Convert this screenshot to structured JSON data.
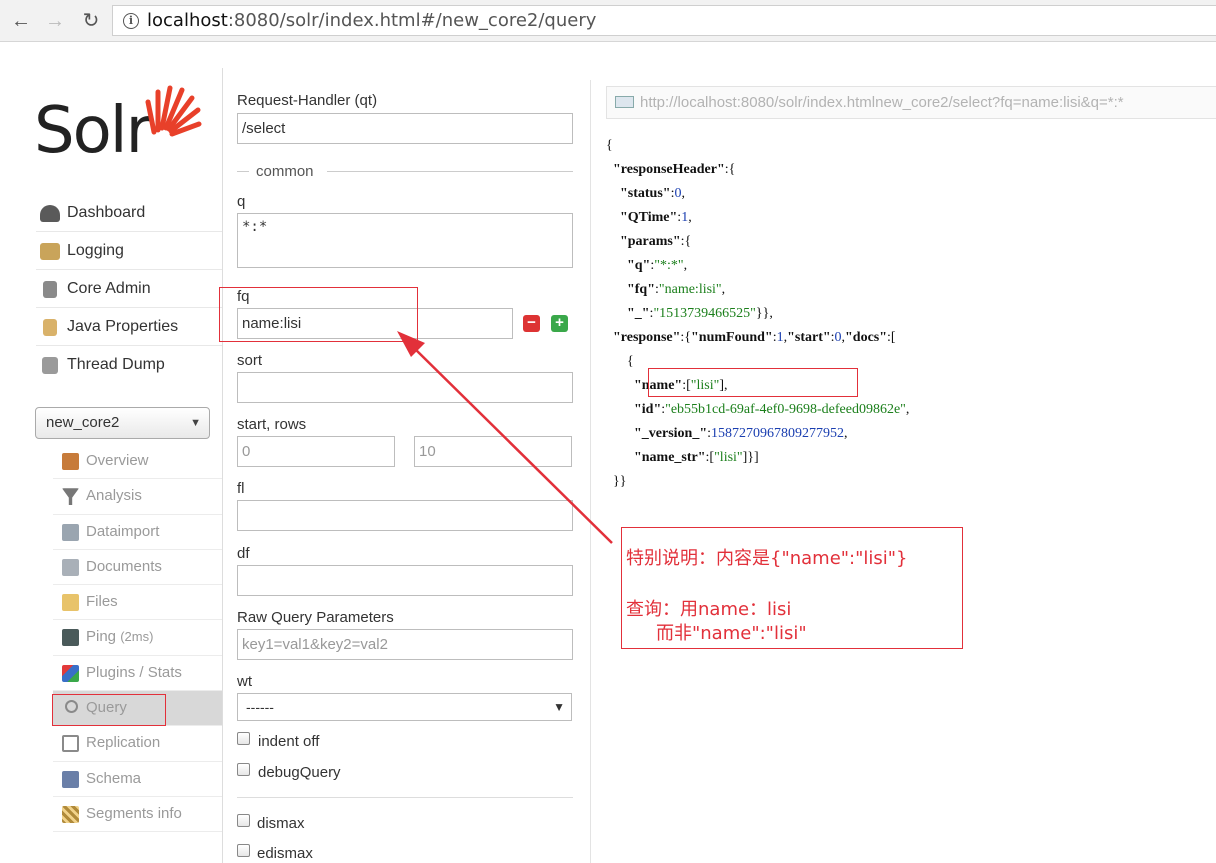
{
  "browser": {
    "back": "←",
    "forward": "→",
    "reload": "↻",
    "url_host": "localhost",
    "url_rest": ":8080/solr/index.html#/new_core2/query"
  },
  "logo": {
    "text": "Solr"
  },
  "menu": [
    {
      "label": "Dashboard",
      "icon": "dashboard-icon",
      "color": "#5a5a5a"
    },
    {
      "label": "Logging",
      "icon": "logging-icon",
      "color": "#c9a45a"
    },
    {
      "label": "Core Admin",
      "icon": "core-admin-icon",
      "color": "#8a8a8a"
    },
    {
      "label": "Java Properties",
      "icon": "java-icon",
      "color": "#d9b26a"
    },
    {
      "label": "Thread Dump",
      "icon": "thread-dump-icon",
      "color": "#9a9a9a"
    }
  ],
  "core_selector": {
    "value": "new_core2"
  },
  "submenu": [
    {
      "label": "Overview",
      "suffix": "",
      "icon": "home-icon",
      "color": "#c77b3a"
    },
    {
      "label": "Analysis",
      "suffix": "",
      "icon": "funnel-icon",
      "color": "#777777"
    },
    {
      "label": "Dataimport",
      "suffix": "",
      "icon": "dataimport-icon",
      "color": "#9aa5b0"
    },
    {
      "label": "Documents",
      "suffix": "",
      "icon": "documents-icon",
      "color": "#a9b0b8"
    },
    {
      "label": "Files",
      "suffix": "",
      "icon": "folder-icon",
      "color": "#e8c36a"
    },
    {
      "label": "Ping",
      "suffix": "(2ms)",
      "icon": "ping-icon",
      "color": "#4a5a5a"
    },
    {
      "label": "Plugins / Stats",
      "suffix": "",
      "icon": "plugins-icon",
      "color": "#3a6fc8"
    },
    {
      "label": "Query",
      "suffix": "",
      "icon": "magnifier-icon",
      "color": "#8a8a8a"
    },
    {
      "label": "Replication",
      "suffix": "",
      "icon": "replication-icon",
      "color": "#8a8a8a"
    },
    {
      "label": "Schema",
      "suffix": "",
      "icon": "schema-icon",
      "color": "#6a7fa8"
    },
    {
      "label": "Segments info",
      "suffix": "",
      "icon": "segments-icon",
      "color": "#b08a3a"
    }
  ],
  "form": {
    "request_handler_label": "Request-Handler (qt)",
    "request_handler_value": "/select",
    "common_label": "common",
    "q_label": "q",
    "q_value": "*:*",
    "fq_label": "fq",
    "fq_value": "name:lisi",
    "remove_symbol": "−",
    "add_symbol": "+",
    "sort_label": "sort",
    "start_rows_label": "start, rows",
    "start_placeholder": "0",
    "rows_placeholder": "10",
    "fl_label": "fl",
    "df_label": "df",
    "raw_label": "Raw Query Parameters",
    "raw_placeholder": "key1=val1&key2=val2",
    "wt_label": "wt",
    "wt_value": "------",
    "indent_label": "indent off",
    "debug_label": "debugQuery",
    "dismax_label": "dismax",
    "edismax_label": "edismax"
  },
  "response": {
    "request_url": "http://localhost:8080/solr/index.htmlnew_core2/select?fq=name:lisi&q=*:*",
    "json_lines": [
      [
        [
          "p",
          "{"
        ]
      ],
      [
        [
          "p",
          "  "
        ],
        [
          "k",
          "\"responseHeader\""
        ],
        [
          "p",
          ":{"
        ]
      ],
      [
        [
          "p",
          "    "
        ],
        [
          "k",
          "\"status\""
        ],
        [
          "p",
          ":"
        ],
        [
          "n",
          "0"
        ],
        [
          "p",
          ","
        ]
      ],
      [
        [
          "p",
          "    "
        ],
        [
          "k",
          "\"QTime\""
        ],
        [
          "p",
          ":"
        ],
        [
          "n",
          "1"
        ],
        [
          "p",
          ","
        ]
      ],
      [
        [
          "p",
          "    "
        ],
        [
          "k",
          "\"params\""
        ],
        [
          "p",
          ":{"
        ]
      ],
      [
        [
          "p",
          "      "
        ],
        [
          "k",
          "\"q\""
        ],
        [
          "p",
          ":"
        ],
        [
          "s",
          "\"*:*\""
        ],
        [
          "p",
          ","
        ]
      ],
      [
        [
          "p",
          "      "
        ],
        [
          "k",
          "\"fq\""
        ],
        [
          "p",
          ":"
        ],
        [
          "s",
          "\"name:lisi\""
        ],
        [
          "p",
          ","
        ]
      ],
      [
        [
          "p",
          "      "
        ],
        [
          "k",
          "\"_\""
        ],
        [
          "p",
          ":"
        ],
        [
          "s",
          "\"1513739466525\""
        ],
        [
          "p",
          "}},"
        ]
      ],
      [
        [
          "p",
          "  "
        ],
        [
          "k",
          "\"response\""
        ],
        [
          "p",
          ":{"
        ],
        [
          "k",
          "\"numFound\""
        ],
        [
          "p",
          ":"
        ],
        [
          "n",
          "1"
        ],
        [
          "p",
          ","
        ],
        [
          "k",
          "\"start\""
        ],
        [
          "p",
          ":"
        ],
        [
          "n",
          "0"
        ],
        [
          "p",
          ","
        ],
        [
          "k",
          "\"docs\""
        ],
        [
          "p",
          ":["
        ]
      ],
      [
        [
          "p",
          "      {"
        ]
      ],
      [
        [
          "p",
          "        "
        ],
        [
          "k",
          "\"name\""
        ],
        [
          "p",
          ":["
        ],
        [
          "s",
          "\"lisi\""
        ],
        [
          "p",
          "],"
        ]
      ],
      [
        [
          "p",
          "        "
        ],
        [
          "k",
          "\"id\""
        ],
        [
          "p",
          ":"
        ],
        [
          "s",
          "\"eb55b1cd-69af-4ef0-9698-defeed09862e\""
        ],
        [
          "p",
          ","
        ]
      ],
      [
        [
          "p",
          "        "
        ],
        [
          "k",
          "\"_version_\""
        ],
        [
          "p",
          ":"
        ],
        [
          "n",
          "1587270967809277952"
        ],
        [
          "p",
          ","
        ]
      ],
      [
        [
          "p",
          "        "
        ],
        [
          "k",
          "\"name_str\""
        ],
        [
          "p",
          ":["
        ],
        [
          "s",
          "\"lisi\""
        ],
        [
          "p",
          "]}]"
        ]
      ],
      [
        [
          "p",
          "  }}"
        ]
      ]
    ]
  },
  "annotation": {
    "line1": "特别说明：内容是{\"name\":\"lisi\"}",
    "line2": "查询：用name：lisi",
    "line3": "而非\"name\":\"lisi\"",
    "color": "#e2303a"
  }
}
